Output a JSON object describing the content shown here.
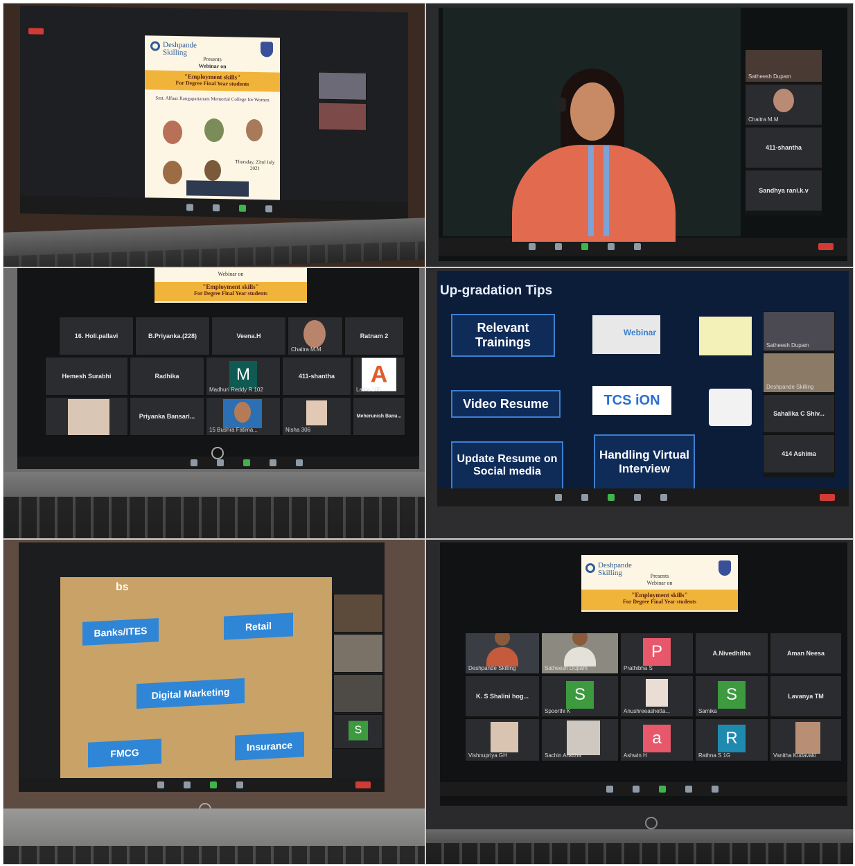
{
  "panel1": {
    "poster": {
      "logo": "Deshpande Skilling",
      "presents": "Presents",
      "webinar": "Webinar on",
      "title": "\"Employment skills\"",
      "subtitle": "For Degree Final Year students",
      "org": "Smt. Alfaaz Rangapattanam Memorial College for Women",
      "date": "Thursday, 22nd July 2021"
    }
  },
  "panel2": {
    "participants": [
      {
        "name": "Satheesh Dupam"
      },
      {
        "name": "Chaitra M.M"
      },
      {
        "name": "411-shantha"
      },
      {
        "name": "Sandhya rani.k.v"
      }
    ]
  },
  "panel3": {
    "poster": {
      "webinar": "Webinar on",
      "title": "\"Employment skills\"",
      "subtitle": "For Degree Final Year students"
    },
    "grid": [
      {
        "name": "16. Holi.pallavi"
      },
      {
        "name": "B.Priyanka.(228)"
      },
      {
        "name": "Veena.H"
      },
      {
        "name": "Chaitra M.M"
      },
      {
        "name": "Ratnam 2"
      },
      {
        "name": "Hemesh Surabhi"
      },
      {
        "name": "Radhika"
      },
      {
        "name": "M",
        "caption": "Madhuri Reddy R 102"
      },
      {
        "name": "411-shantha"
      },
      {
        "name": "A",
        "caption": "Latha 105"
      },
      {
        "name": ""
      },
      {
        "name": "Priyanka Bansari..."
      },
      {
        "name": "",
        "caption": "15 Bushra Fatima..."
      },
      {
        "name": "",
        "caption": "Nisha 306"
      },
      {
        "name": "Meherunish Banu..."
      }
    ]
  },
  "panel4": {
    "heading": "Up-gradation Tips",
    "tips": [
      "Relevant Trainings",
      "Video Resume",
      "Update Resume on Social media",
      "Handling Virtual Interview"
    ],
    "logos": {
      "webinar": "Webinar",
      "tcs": "TCS iON"
    },
    "side": [
      {
        "name": "Satheesh Dupam"
      },
      {
        "name": "Deshpande Skilling"
      },
      {
        "name": "Sahalika C Shiv..."
      },
      {
        "name": "414 Ashima"
      }
    ]
  },
  "panel5": {
    "heading": "bs",
    "tags": [
      "Banks/ITES",
      "Retail",
      "Digital Marketing",
      "FMCG",
      "Insurance"
    ],
    "side_letter": "S"
  },
  "panel6": {
    "poster": {
      "logo": "Deshpande Skilling",
      "presents": "Presents",
      "webinar": "Webinar on",
      "title": "\"Employment skills\"",
      "subtitle": "For Degree Final Year students"
    },
    "grid": [
      {
        "name": "",
        "caption": "Deshpande Skilling"
      },
      {
        "name": "",
        "caption": "Satheesh Dupam"
      },
      {
        "name": "P",
        "caption": "Prathibha S"
      },
      {
        "name": "A.Nivedhitha"
      },
      {
        "name": "Aman Neesa"
      },
      {
        "name": "K. S Shalini hog..."
      },
      {
        "name": "S",
        "caption": "Spoorthi K"
      },
      {
        "name": "",
        "caption": "Anushreeashetta..."
      },
      {
        "name": "S",
        "caption": "Samika"
      },
      {
        "name": "Lavanya TM"
      },
      {
        "name": "",
        "caption": "Vishnupriya GH"
      },
      {
        "name": "",
        "caption": "Sachin Ankitha"
      },
      {
        "name": "a",
        "caption": "Ashwin H"
      },
      {
        "name": "R",
        "caption": "Rathna S 1G"
      },
      {
        "name": "",
        "caption": "Vanitha Kudavaki"
      }
    ]
  },
  "colors": {
    "zoom_green": "#3fb44b",
    "zoom_red": "#d23b35",
    "banner_orange": "#f1b43a",
    "slide_blue": "#2f86d6",
    "slide_navy": "#0f2c59",
    "avatar_pink": "#e8586b",
    "avatar_green": "#3d9a3f",
    "avatar_teal": "#1f8ab0"
  }
}
